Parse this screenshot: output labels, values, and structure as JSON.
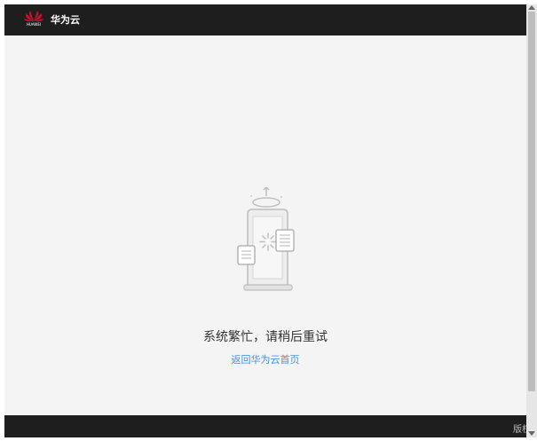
{
  "header": {
    "logo_text": "HUAWEI",
    "brand_name": "华为云"
  },
  "main": {
    "message": "系统繁忙，请稍后重试",
    "home_link": "返回华为云首页"
  },
  "footer": {
    "text": "版权"
  },
  "colors": {
    "header_bg": "#1e1e1e",
    "page_bg": "#f4f4f4",
    "link": "#4a90e2",
    "logo_red": "#cf0a2c"
  }
}
